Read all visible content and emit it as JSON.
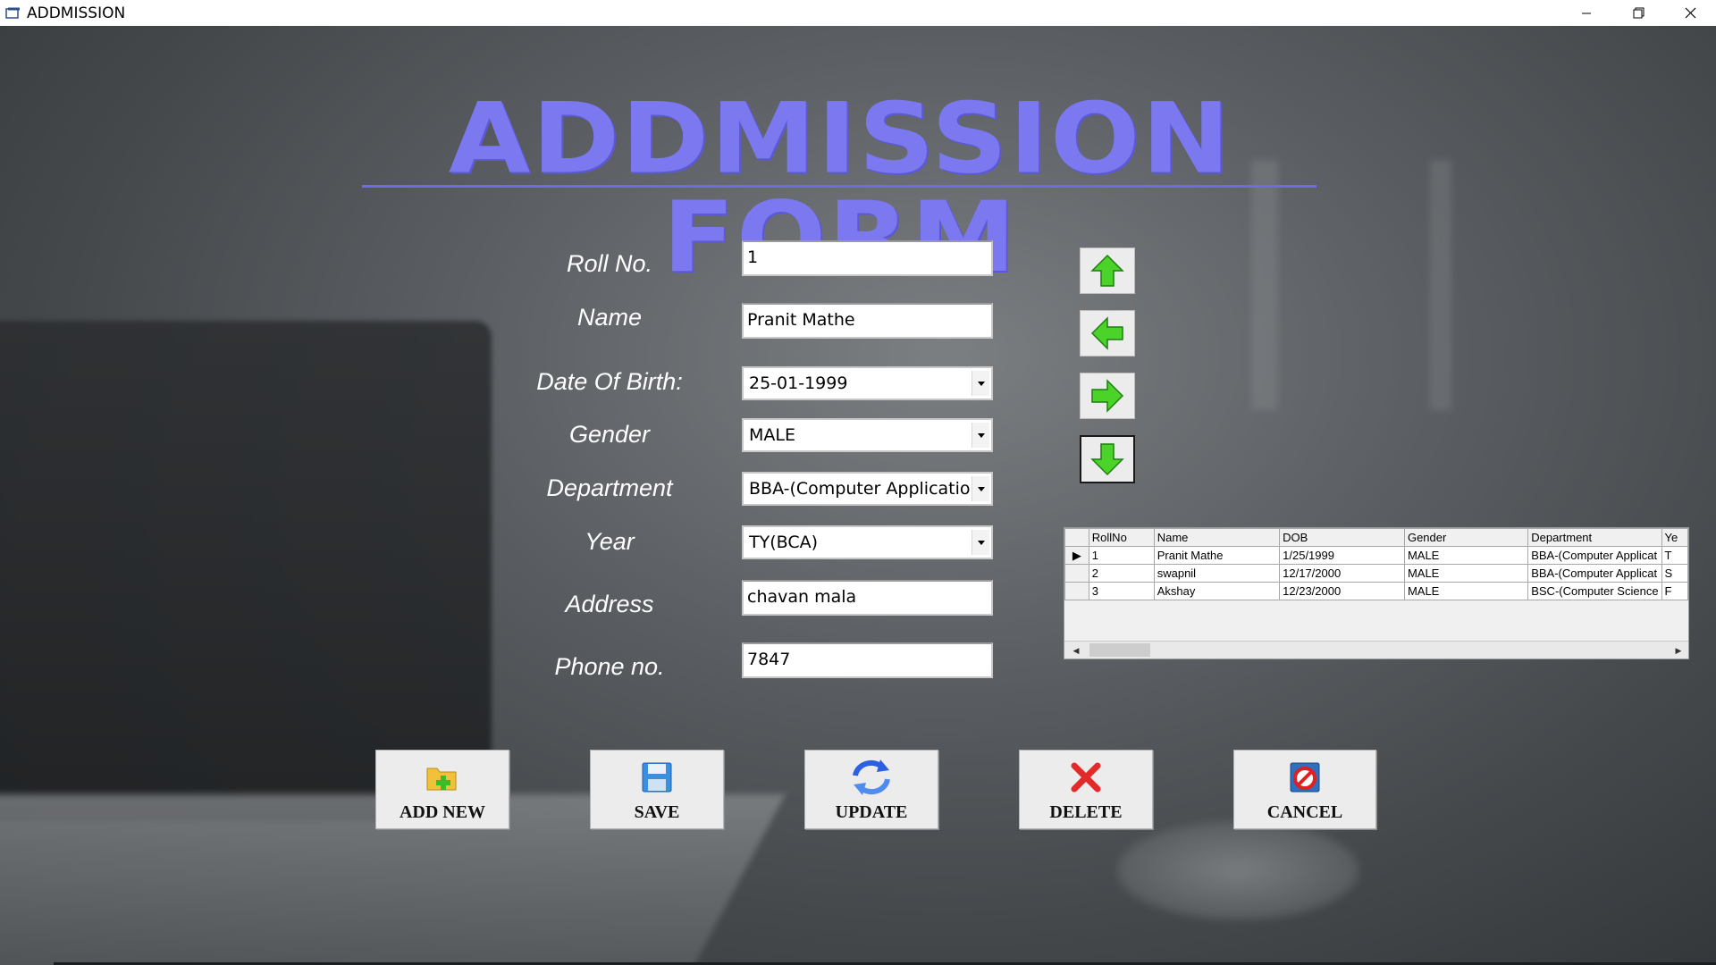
{
  "window": {
    "title": "ADDMISSION",
    "controls": {
      "minimize": "—",
      "maximize": "❐",
      "close": "✕"
    }
  },
  "form": {
    "heading": "ADDMISSION FORM",
    "labels": {
      "roll_no": "Roll No.",
      "name": "Name",
      "dob": "Date Of Birth:",
      "gender": "Gender",
      "department": "Department",
      "year": "Year",
      "address": "Address",
      "phone": "Phone no."
    },
    "values": {
      "roll_no": "1",
      "name": "Pranit Mathe",
      "dob": "25-01-1999",
      "gender": "MALE",
      "department": "BBA-(Computer Application)",
      "year": "TY(BCA)",
      "address": "chavan mala",
      "phone": "7847"
    }
  },
  "navigation": {
    "first_icon": "arrow-up-icon",
    "previous_icon": "arrow-left-icon",
    "next_icon": "arrow-right-icon",
    "last_icon": "arrow-down-icon",
    "arrow_color": "#4cd32a"
  },
  "grid": {
    "columns": [
      "RollNo",
      "Name",
      "DOB",
      "Gender",
      "Department",
      "Ye"
    ],
    "rows": [
      [
        "1",
        "Pranit Mathe",
        "1/25/1999",
        "MALE",
        "BBA-(Computer Applicat",
        "T"
      ],
      [
        "2",
        "swapnil",
        "12/17/2000",
        "MALE",
        "BBA-(Computer Applicat",
        "S"
      ],
      [
        "3",
        "Akshay",
        "12/23/2000",
        "MALE",
        "BSC-(Computer Science",
        "F"
      ]
    ],
    "current_row_marker": "▶"
  },
  "actions": {
    "add_new": "ADD NEW",
    "save": "SAVE",
    "update": "UPDATE",
    "delete": "DELETE",
    "cancel": "CANCEL"
  },
  "colors": {
    "heading": "#7b78f0",
    "label": "#ffffff",
    "button_face": "#ececec"
  }
}
